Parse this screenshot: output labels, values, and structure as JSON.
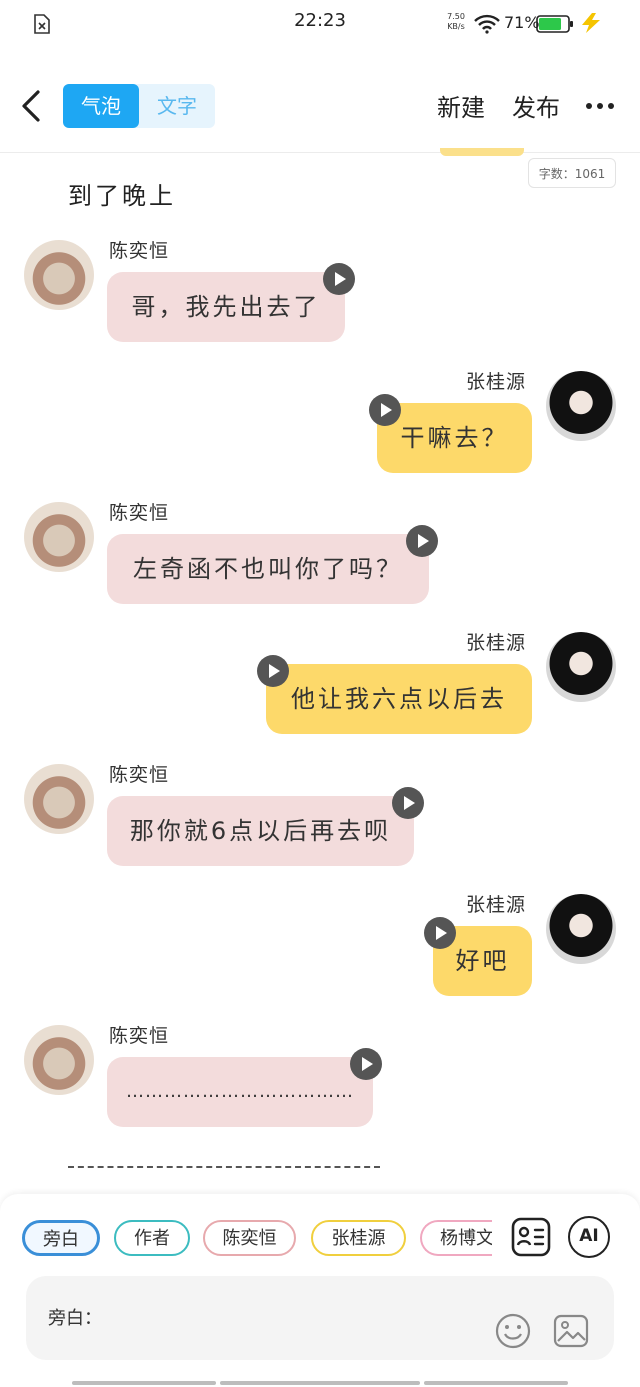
{
  "status_bar": {
    "time": "22:23",
    "net_speed": "7.50",
    "net_unit": "KB/s",
    "battery": "71%"
  },
  "header": {
    "tab_bubble": "气泡",
    "tab_text": "文字",
    "new_label": "新建",
    "publish_label": "发布"
  },
  "word_count": "字数：1061",
  "narration": "到了晚上",
  "messages": [
    {
      "speaker": "陈奕恒",
      "text": "哥，我先出去了"
    },
    {
      "speaker": "张桂源",
      "text": "干嘛去？"
    },
    {
      "speaker": "陈奕恒",
      "text": "左奇函不也叫你了吗？"
    },
    {
      "speaker": "张桂源",
      "text": "他让我六点以后去"
    },
    {
      "speaker": "陈奕恒",
      "text": "那你就6点以后再去呗"
    },
    {
      "speaker": "张桂源",
      "text": "好吧"
    },
    {
      "speaker": "陈奕恒",
      "text": "………………………………"
    }
  ],
  "chips": [
    "旁白",
    "作者",
    "陈奕恒",
    "张桂源",
    "杨博文"
  ],
  "ai_label": "AI",
  "input_label": "旁白：",
  "colors": {
    "accent": "#1ea7f3",
    "pink_bubble": "#f3dcdc",
    "yellow_bubble": "#fdd96a"
  }
}
